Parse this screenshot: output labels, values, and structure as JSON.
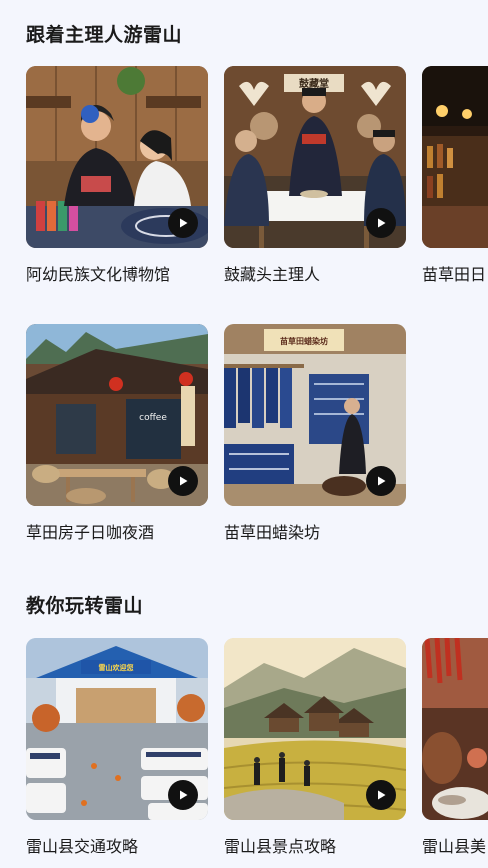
{
  "sections": [
    {
      "title": "跟着主理人游雷山",
      "cards": [
        {
          "caption": "阿幼民族文化博物馆"
        },
        {
          "caption": "鼓藏头主理人",
          "sign": "鼓藏堂"
        },
        {
          "caption": "苗草田日"
        }
      ]
    },
    {
      "cards": [
        {
          "caption": "草田房子日咖夜酒",
          "sign": "coffee"
        },
        {
          "caption": "苗草田蜡染坊",
          "sign": "苗草田蜡染坊"
        }
      ]
    },
    {
      "title": "教你玩转雷山",
      "cards": [
        {
          "caption": "雷山县交通攻略",
          "sign": "雷山欢迎您"
        },
        {
          "caption": "雷山县景点攻略"
        },
        {
          "caption": "雷山县美"
        }
      ]
    }
  ]
}
